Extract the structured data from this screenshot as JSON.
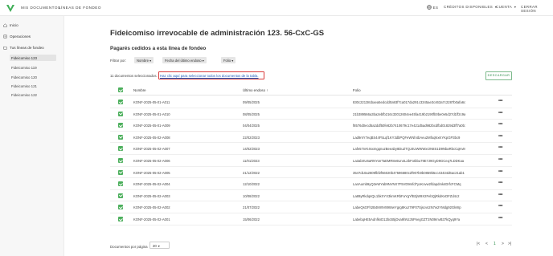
{
  "topbar": {
    "nav": [
      "MIS DOCUMENTOS",
      "LÍNEAS DE FONDEO"
    ],
    "lang": "ES",
    "credits": "CRÉDITOS DISPONIBLES",
    "account": "CUENTA",
    "logout": "CERRAR SESIÓN"
  },
  "sidebar": {
    "items": [
      {
        "label": "Inicio",
        "icon": "home-icon"
      },
      {
        "label": "Operaciones",
        "icon": "operations-icon"
      },
      {
        "label": "Tus líneas de fondeo",
        "icon": "folder-icon"
      }
    ],
    "sub_items": [
      "Fideicomiso 123",
      "Fideicomiso 119",
      "Fideicomiso 120",
      "Fideicomiso 121",
      "Fideicomiso 122"
    ]
  },
  "main": {
    "title": "Fideicomiso irrevocable de administración 123. 56-CxC-GS",
    "subtitle": "Pagarés cedidos a esta línea de fondeo",
    "filter_label": "Filtrar por:",
    "filters": [
      "Nombre",
      "Fecha del último endoso",
      "Folio"
    ],
    "selection_text": "11 documentos seleccionados.",
    "select_all_link": "Haz clic aquí para seleccionar todos los documentos de la tabla.",
    "download_label": "DESCARGAR",
    "columns": [
      "Nombre",
      "Último endoso",
      "Folio"
    ],
    "rows": [
      {
        "name": "KONF-2025-05-01-A011",
        "date": "09/05/2025",
        "folio": "830c22138cbaea5edcdd0a93f7ca017da291c3345ae3c463a7c2287b0afa6c73"
      },
      {
        "name": "KONF-2025-05-01-A010",
        "date": "08/05/2025",
        "folio": "21b389566a3ba2ebfb216c33012604ee45fa419b2190fb0be0e5d27d1ff2c9a8"
      },
      {
        "name": "KONF-2025-05-01-A009",
        "date": "04/04/2025",
        "folio": "f8576d0ecd5a2ddf50fe82b7410679c17e421d5ad982bcdfbd01829d3ff7a0b1"
      },
      {
        "name": "KONF-2025-05-02-A008",
        "date": "22/02/2023",
        "folio": "Lad9rsY7eqBS44F5Lqf1KY3dbPQFeWNh4bAeu2MfoqNxKYKpGP3bc9"
      },
      {
        "name": "KONF-2025-05-02-A007",
        "date": "14/02/2023",
        "folio": "Lafe57nrK4sxmgqnuzBeeaby8DuZTQJ4UWWWxr2N8S1D9NbaRbcCqKvM"
      },
      {
        "name": "KONF-2025-05-02-A006",
        "date": "11/01/2023",
        "folio": "La3abXU6aRNYorrTaEMR8e6Un4L2bFoIbbu79E7J9GyD9GCeq7LDDKaa"
      },
      {
        "name": "KONF-2025-05-02-A005",
        "date": "21/12/2022",
        "folio": "3547d10a2809fbf2f56020b47596680c2f907b0b0859b5cc43434d6ac21ab1"
      },
      {
        "name": "KONF-2025-05-02-A004",
        "date": "12/10/2022",
        "folio": "La4Aumb9yQ2eWYab9NVNX7F5VD9mfd7yoKovw2fdapdmk4DrfcFCMq"
      },
      {
        "name": "KONF-2025-05-02-A003",
        "date": "10/08/2022",
        "folio": "La89yRkdqsQL1bkXYX3kmKRbFaYgYfB2jW9X2FebQjRkdKvDFZd4c2"
      },
      {
        "name": "KONF-2025-05-02-A002",
        "date": "21/07/2022",
        "folio": "LabeQsGFh2B4Mr9V89WwYgrg8Kuz79F07Sjscvs2N7w2YMdg92GkWp"
      },
      {
        "name": "KONF-2025-05-02-A001",
        "date": "15/06/2022",
        "folio": "LabebqHE5AdnfknD12bcB5jDva9hNzJ5PnegGZT2N09mvB37kQyq9Ya"
      }
    ],
    "per_page_label": "Documentos por página",
    "per_page_value": "20",
    "current_page": "1"
  },
  "colors": {
    "accent": "#4caf5c",
    "link": "#1f5fbf",
    "highlight_border": "#d93a3a"
  }
}
